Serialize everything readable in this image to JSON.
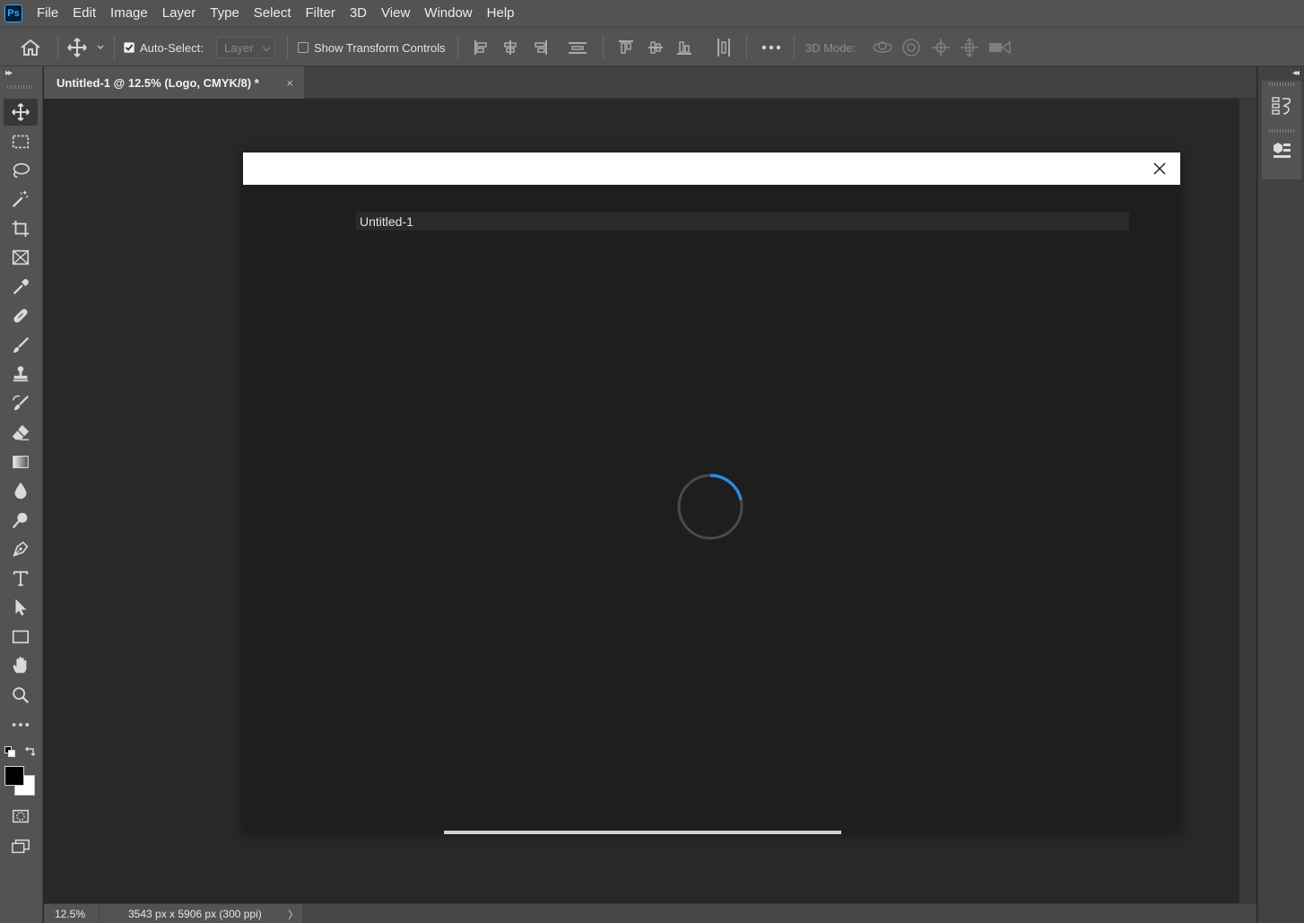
{
  "app": {
    "logo_text": "Ps",
    "accent": "#31a8ff"
  },
  "menu": [
    "File",
    "Edit",
    "Image",
    "Layer",
    "Type",
    "Select",
    "Filter",
    "3D",
    "View",
    "Window",
    "Help"
  ],
  "options": {
    "auto_select_label": "Auto-Select:",
    "auto_select_checked": true,
    "layer_select_value": "Layer",
    "show_transform_label": "Show Transform Controls",
    "show_transform_checked": false,
    "mode_label": "3D Mode:"
  },
  "tab": {
    "title": "Untitled-1 @ 12.5% (Logo, CMYK/8) *",
    "close": "×"
  },
  "tools": [
    "move-tool",
    "marquee-tool",
    "lasso-tool",
    "magic-wand-tool",
    "crop-tool",
    "frame-tool",
    "eyedropper-tool",
    "healing-brush-tool",
    "brush-tool",
    "clone-stamp-tool",
    "history-brush-tool",
    "eraser-tool",
    "gradient-tool",
    "blur-tool",
    "dodge-tool",
    "pen-tool",
    "type-tool",
    "path-selection-tool",
    "rectangle-tool",
    "hand-tool",
    "zoom-tool",
    "more-tools"
  ],
  "colors": {
    "foreground": "#000000",
    "background": "#ffffff",
    "spinner_accent": "#2b8ae3"
  },
  "dialog": {
    "document_name": "Untitled-1",
    "loading": true,
    "progress_fraction": 1.0
  },
  "status": {
    "zoom": "12.5%",
    "doc_info": "3543 px x 5906 px (300 ppi)",
    "arrow": "〉"
  }
}
